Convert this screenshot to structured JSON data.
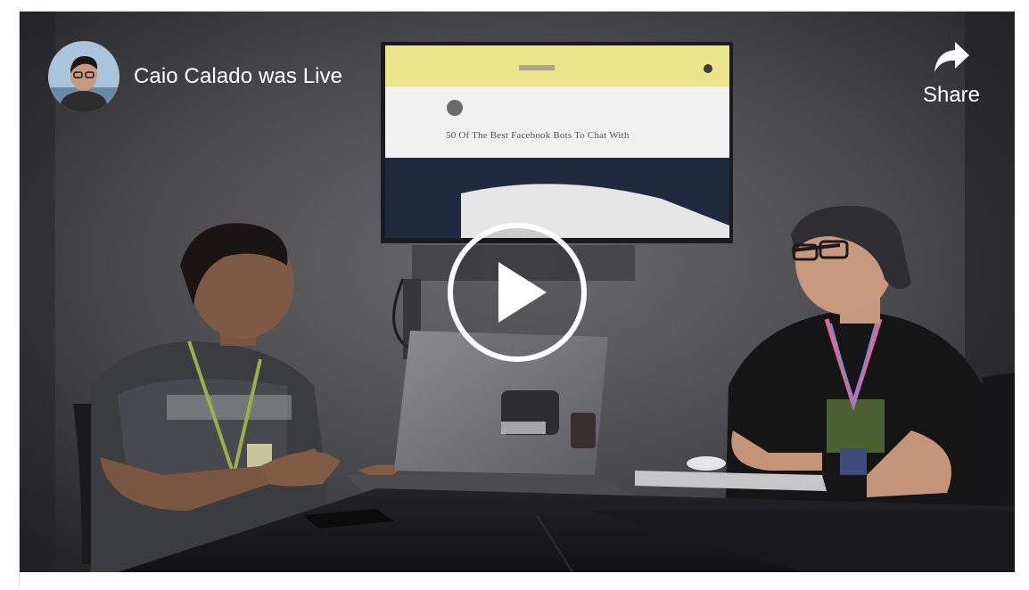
{
  "post": {
    "title": "Caio Calado was Live"
  },
  "share": {
    "label": "Share"
  },
  "screen_display": {
    "article_title": "50 Of The Best Facebook Bots To Chat With"
  },
  "colors": {
    "overlay_text": "#ffffff",
    "tv_header": "#f3ea7c",
    "border": "#dddfe2"
  },
  "icons": [
    "share-arrow-icon",
    "play-icon"
  ]
}
